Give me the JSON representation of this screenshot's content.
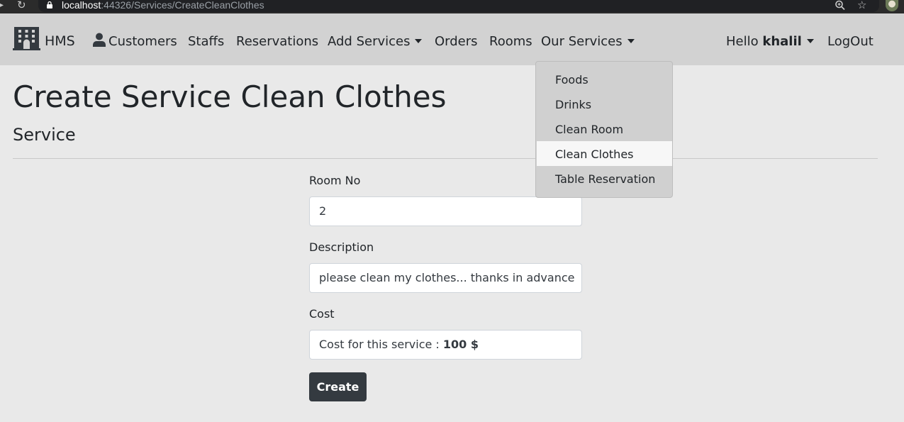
{
  "browser": {
    "url_host": "localhost",
    "url_rest": ":44326/Services/CreateCleanClothes"
  },
  "navbar": {
    "brand": "HMS",
    "items": [
      {
        "label": "Customers"
      },
      {
        "label": "Staffs"
      },
      {
        "label": "Reservations"
      },
      {
        "label": "Add Services"
      },
      {
        "label": "Orders"
      },
      {
        "label": "Rooms"
      },
      {
        "label": "Our Services"
      }
    ],
    "greeting": "Hello",
    "username": "khalil",
    "logout": "LogOut"
  },
  "dropdown": {
    "items": [
      "Foods",
      "Drinks",
      "Clean Room",
      "Clean Clothes",
      "Table Reservation"
    ],
    "active": "Clean Clothes"
  },
  "page": {
    "title": "Create Service Clean Clothes",
    "subtitle": "Service"
  },
  "form": {
    "room_label": "Room No",
    "room_value": "2",
    "description_label": "Description",
    "description_value": "please clean my clothes... thanks in advance",
    "cost_label": "Cost",
    "cost_prefix": "Cost for this service : ",
    "cost_amount": "100 $",
    "submit_label": "Create"
  }
}
